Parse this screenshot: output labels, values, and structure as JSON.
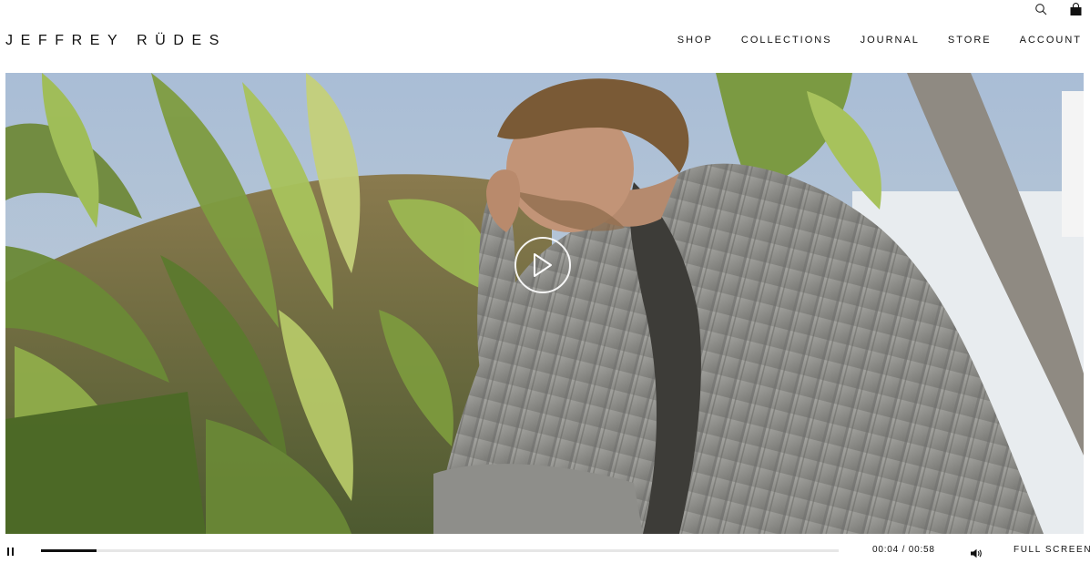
{
  "brand": {
    "logo_text": "JEFFREY RÜDES"
  },
  "utility": {
    "search_icon": "search-icon",
    "bag_icon": "shopping-bag-icon"
  },
  "nav": {
    "items": [
      {
        "label": "SHOP"
      },
      {
        "label": "COLLECTIONS"
      },
      {
        "label": "JOURNAL"
      },
      {
        "label": "STORE"
      },
      {
        "label": "ACCOUNT"
      }
    ]
  },
  "video": {
    "play_icon": "play-icon",
    "progress_fraction": 0.07,
    "current_time": "00:04",
    "separator": " / ",
    "duration": "00:58",
    "time_display": "00:04 / 00:58",
    "volume_icon": "volume-icon",
    "pause_icon": "pause-icon",
    "fullscreen_label": "FULL SCREEN"
  }
}
